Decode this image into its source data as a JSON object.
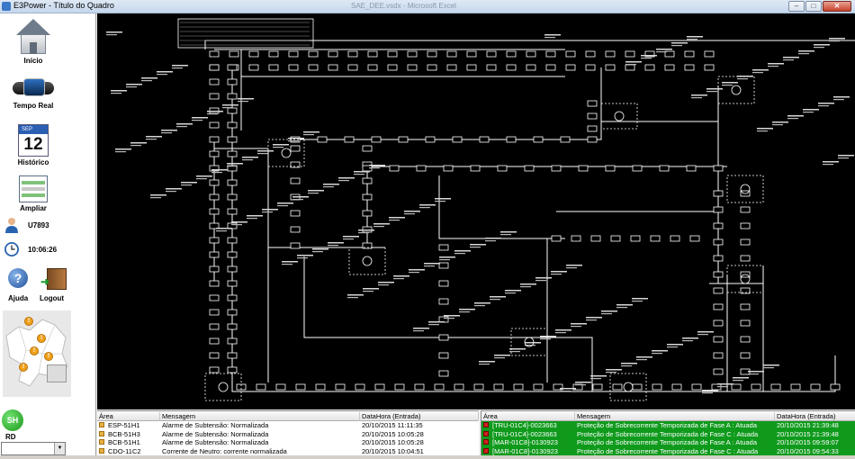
{
  "window": {
    "title": "E3Power - Título do Quadro",
    "center_title": "SAE_DEE.vsdx - Microsoft Excel",
    "buttons": {
      "minimize": "–",
      "maximize": "□",
      "close": "✕"
    }
  },
  "sidebar": {
    "inicio": "Início",
    "tempo_real": "Tempo Real",
    "historico": "Histórico",
    "calendar_month": "SEP",
    "calendar_day": "12",
    "ampliar": "Ampliar",
    "user": "U7893",
    "time": "10:06:26",
    "ajuda": "Ajuda",
    "logout": "Logout",
    "sh_badge": "SH",
    "rd_label": "RD",
    "rd_value": "",
    "warning_symbol": "!"
  },
  "alarms_left": {
    "headers": [
      "Área",
      "Mensagem",
      "DataHora (Entrada)"
    ],
    "rows": [
      {
        "area": "ESP-51H1",
        "msg": "Alarme de Subtensão: Normalizada",
        "dt": "20/10/2015 11:11:35"
      },
      {
        "area": "BCB-51H3",
        "msg": "Alarme de Subtensão: Normalizada",
        "dt": "20/10/2015 10:05:28"
      },
      {
        "area": "BCB-51H1",
        "msg": "Alarme de Subtensão: Normalizada",
        "dt": "20/10/2015 10:05:28"
      },
      {
        "area": "CDO-11C2",
        "msg": "Corrente de Neutro: corrente normalizada",
        "dt": "20/10/2015 10:04:51"
      }
    ]
  },
  "alarms_right": {
    "headers": [
      "Área",
      "Mensagem",
      "DataHora (Entrada)"
    ],
    "rows": [
      {
        "area": "[TRU-01C4]-0023663",
        "msg": "Proteção de Sobrecorrente Temporizada  de Fase A : Atuada",
        "dt": "20/10/2015 21:39:48"
      },
      {
        "area": "[TRU-01C4]-0023663",
        "msg": "Proteção de Sobrecorrente Temporizada  de Fase C : Atuada",
        "dt": "20/10/2015 21:39:48"
      },
      {
        "area": "[MAR-01C8]-0130923",
        "msg": "Proteção de Sobrecorrente Temporizada  de Fase A : Atuada",
        "dt": "20/10/2015 09:59:07"
      },
      {
        "area": "[MAR-01C8]-0130923",
        "msg": "Proteção de Sobrecorrente Temporizada  de Fase C : Atuada",
        "dt": "20/10/2015 09:54:33"
      }
    ]
  },
  "colors": {
    "alarm_active_bg": "#0f9a1c",
    "schematic_bg": "#000000",
    "schematic_line": "#ffffff"
  }
}
